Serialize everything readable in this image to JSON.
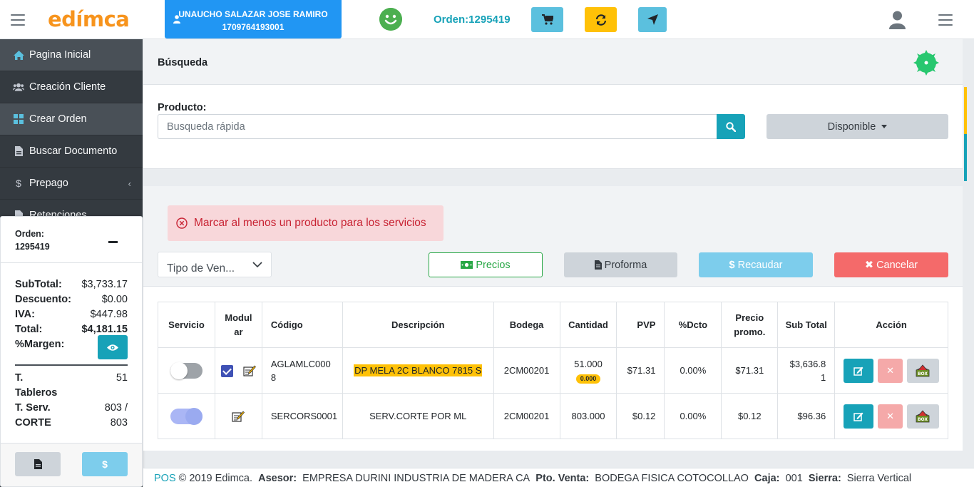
{
  "header": {
    "logo": "edímca",
    "user_name": "UNAUCHO SALAZAR JOSE RAMIRO",
    "user_id": "1709764193001",
    "orden_link": "Orden:1295419"
  },
  "sidebar": {
    "items": [
      {
        "label": "Pagina Inicial"
      },
      {
        "label": "Creación Cliente"
      },
      {
        "label": "Crear Orden"
      },
      {
        "label": "Buscar Documento"
      },
      {
        "label": "Prepago"
      },
      {
        "label": "Retenciones"
      }
    ]
  },
  "summary": {
    "orden_label": "Orden:",
    "orden_number": "1295419",
    "subtotal_label": "SubTotal:",
    "subtotal": "$3,733.17",
    "descuento_label": "Descuento:",
    "descuento": "$0.00",
    "iva_label": "IVA:",
    "iva": "$447.98",
    "total_label": "Total:",
    "total": "$4,181.15",
    "margen_label": "%Margen:",
    "tableros_label": "T. Tableros",
    "tableros": "51",
    "serv_label": "T. Serv. CORTE",
    "serv": "803 / 803"
  },
  "search": {
    "title": "Búsqueda",
    "product_label": "Producto:",
    "placeholder": "Busqueda rápida",
    "disponible": "Disponible"
  },
  "main": {
    "alert": "Marcar al menos un producto para los servicios",
    "tipo_venta": "Tipo de Ven...",
    "btn_precios": "Precios",
    "btn_proforma": "Proforma",
    "btn_recaudar": "Recaudar",
    "btn_cancelar": "Cancelar"
  },
  "table": {
    "headers": {
      "servicio": "Servicio",
      "modular_1": "Modul",
      "modular_2": "ar",
      "codigo": "Código",
      "descripcion": "Descripción",
      "bodega": "Bodega",
      "cantidad": "Cantidad",
      "pvp": "PVP",
      "dcto": "%Dcto",
      "promo_1": "Precio",
      "promo_2": "promo.",
      "subtotal": "Sub Total",
      "accion": "Acción"
    },
    "rows": [
      {
        "servicio_on": false,
        "modular_checked": true,
        "codigo_1": "AGLAMLC000",
        "codigo_2": "8",
        "descripcion": "DP MELA 2C BLANCO 7815 S",
        "bodega": "2CM00201",
        "cantidad": "51.000",
        "cantidad_badge": "0.000",
        "pvp": "$71.31",
        "dcto": "0.00%",
        "promo": "$71.31",
        "subtotal_1": "$3,636.8",
        "subtotal_2": "1"
      },
      {
        "servicio_on": true,
        "modular_checked": false,
        "codigo": "SERCORS0001",
        "descripcion": "SERV.CORTE POR ML",
        "bodega": "2CM00201",
        "cantidad": "803.000",
        "pvp": "$0.12",
        "dcto": "0.00%",
        "promo": "$0.12",
        "subtotal": "$96.36"
      }
    ]
  },
  "footer": {
    "pos": "POS",
    "copyright": " © 2019 Edimca.",
    "asesor_label": "Asesor:",
    "asesor": "EMPRESA DURINI INDUSTRIA DE MADERA CA",
    "pto_label": "Pto. Venta:",
    "pto": "BODEGA FISICA COTOCOLLAO",
    "caja_label": "Caja:",
    "caja": "001",
    "sierra_label": "Sierra:",
    "sierra": "Sierra Vertical"
  },
  "colors": {
    "brand_orange": "#f7941d",
    "primary_blue": "#2196f3",
    "info": "#17a2b8",
    "warning": "#ffc107",
    "danger": "#f46a6a",
    "success": "#28a745",
    "sidebar_bg": "#343a40"
  }
}
